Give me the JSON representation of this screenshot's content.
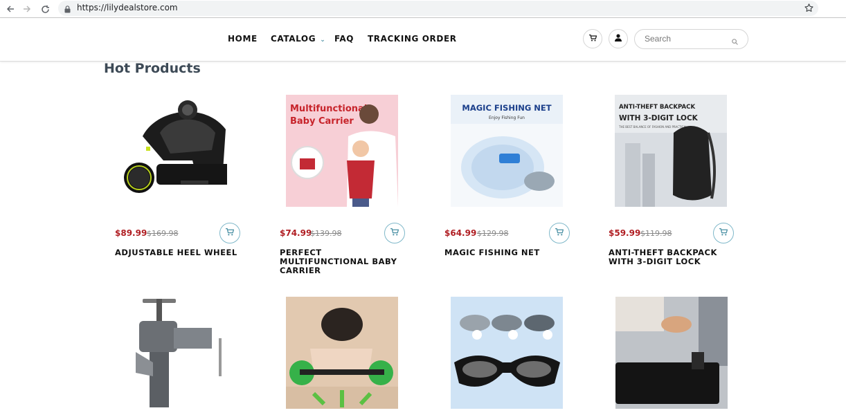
{
  "browser": {
    "url": "https://lilydealstore.com"
  },
  "header": {
    "menu": [
      {
        "label": "HOME"
      },
      {
        "label": "CATALOG"
      },
      {
        "label": "FAQ"
      },
      {
        "label": "TRACKING ORDER"
      }
    ],
    "search_placeholder": "Search"
  },
  "section": {
    "title": "Hot Products"
  },
  "products": [
    {
      "price": "$89.99",
      "old_price": "$169.98",
      "title": "ADJUSTABLE HEEL WHEEL"
    },
    {
      "price": "$74.99",
      "old_price": "$139.98",
      "title": "PERFECT MULTIFUNCTIONAL BABY CARRIER",
      "image_text_1": "Multifunctional",
      "image_text_2": "Baby Carrier"
    },
    {
      "price": "$64.99",
      "old_price": "$129.98",
      "title": "MAGIC FISHING NET",
      "image_text_1": "MAGIC FISHING NET",
      "image_text_2": "Enjoy Fishing Fun"
    },
    {
      "price": "$59.99",
      "old_price": "$119.98",
      "title": "ANTI-THEFT BACKPACK WITH 3-DIGIT LOCK",
      "image_text_1": "ANTI-THEFT BACKPACK",
      "image_text_2": "WITH 3-DIGIT LOCK",
      "image_text_3": "THE BEST BALANCE OF FASHION AND PRACTICAL"
    }
  ],
  "colors": {
    "price": "#b01e23",
    "accent": "#4a90a4",
    "title": "#3d4a56"
  }
}
